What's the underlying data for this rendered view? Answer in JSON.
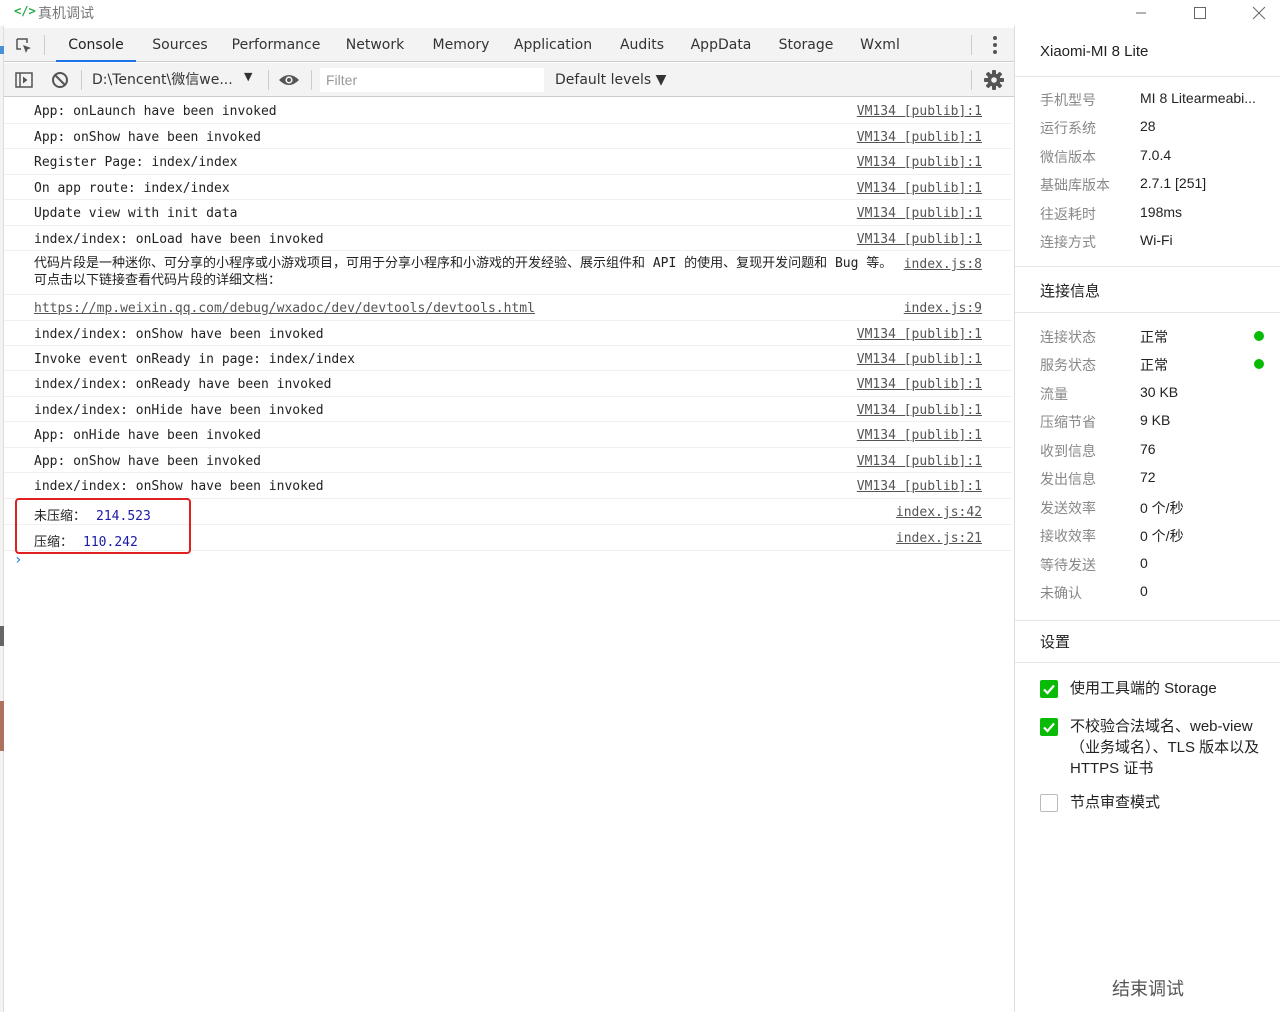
{
  "window": {
    "icon_text": "</>",
    "title": "真机调试",
    "controls": [
      "minimize-icon",
      "maximize-icon",
      "close-icon"
    ]
  },
  "devtools": {
    "tabs": [
      {
        "label": "Console",
        "active": true
      },
      {
        "label": "Sources"
      },
      {
        "label": "Performance"
      },
      {
        "label": "Network"
      },
      {
        "label": "Memory"
      },
      {
        "label": "Application"
      },
      {
        "label": "Audits"
      },
      {
        "label": "AppData"
      },
      {
        "label": "Storage"
      },
      {
        "label": "Wxml"
      }
    ],
    "toolbar": {
      "context": "D:\\Tencent\\微信we...",
      "filter_placeholder": "Filter",
      "levels": "Default levels ▼"
    },
    "console": {
      "rows": [
        {
          "msg": "App: onLaunch have been invoked",
          "src": "VM134 [publib]:1"
        },
        {
          "msg": "App: onShow have been invoked",
          "src": "VM134 [publib]:1"
        },
        {
          "msg": "Register Page: index/index",
          "src": "VM134 [publib]:1"
        },
        {
          "msg": "On app route: index/index",
          "src": "VM134 [publib]:1"
        },
        {
          "msg": "Update view with init data",
          "src": "VM134 [publib]:1"
        },
        {
          "msg": "index/index: onLoad have been invoked",
          "src": "VM134 [publib]:1"
        },
        {
          "msg": "代码片段是一种迷你、可分享的小程序或小游戏项目，可用于分享小程序和小游戏的开发经验、展示组件和 API 的使用、复现开发问题和 Bug 等。可点击以下链接查看代码片段的详细文档：",
          "src": "index.js:8"
        },
        {
          "msg": "https://mp.weixin.qq.com/debug/wxadoc/dev/devtools/devtools.html",
          "src": "index.js:9"
        },
        {
          "msg": "index/index: onShow have been invoked",
          "src": "VM134 [publib]:1"
        },
        {
          "msg": "Invoke event onReady in page: index/index",
          "src": "VM134 [publib]:1"
        },
        {
          "msg": "index/index: onReady have been invoked",
          "src": "VM134 [publib]:1"
        },
        {
          "msg": "index/index: onHide have been invoked",
          "src": "VM134 [publib]:1"
        },
        {
          "msg": "App: onHide have been invoked",
          "src": "VM134 [publib]:1"
        },
        {
          "msg": "App: onShow have been invoked",
          "src": "VM134 [publib]:1"
        },
        {
          "msg": "index/index: onShow have been invoked",
          "src": "VM134 [publib]:1"
        },
        {
          "label": "未压缩：",
          "value": "214.523",
          "src": "index.js:42"
        },
        {
          "label": "压缩：",
          "value": "110.242",
          "src": "index.js:21"
        }
      ],
      "prompt": "›"
    }
  },
  "panel": {
    "device": "Xiaomi-MI 8 Lite",
    "device_info": [
      {
        "k": "手机型号",
        "v": "MI 8 Litearmeabi..."
      },
      {
        "k": "运行系统",
        "v": "28"
      },
      {
        "k": "微信版本",
        "v": "7.0.4"
      },
      {
        "k": "基础库版本",
        "v": "2.7.1 [251]"
      },
      {
        "k": "往返耗时",
        "v": "198ms"
      },
      {
        "k": "连接方式",
        "v": "Wi-Fi"
      }
    ],
    "conn_title": "连接信息",
    "conn_info": [
      {
        "k": "连接状态",
        "v": "正常",
        "dot": true
      },
      {
        "k": "服务状态",
        "v": "正常",
        "dot": true
      },
      {
        "k": "流量",
        "v": "30 KB"
      },
      {
        "k": "压缩节省",
        "v": "9 KB"
      },
      {
        "k": "收到信息",
        "v": "76"
      },
      {
        "k": "发出信息",
        "v": "72"
      },
      {
        "k": "发送效率",
        "v": "0 个/秒"
      },
      {
        "k": "接收效率",
        "v": "0 个/秒"
      },
      {
        "k": "等待发送",
        "v": "0"
      },
      {
        "k": "未确认",
        "v": "0"
      }
    ],
    "settings_title": "设置",
    "settings": [
      {
        "label": "使用工具端的 Storage",
        "checked": true
      },
      {
        "label": "不校验合法域名、web-view（业务域名）、TLS 版本以及 HTTPS 证书",
        "checked": true
      },
      {
        "label": "节点审查模式",
        "checked": false
      }
    ],
    "end_button": "结束调试",
    "status_color": "#09bb07"
  }
}
